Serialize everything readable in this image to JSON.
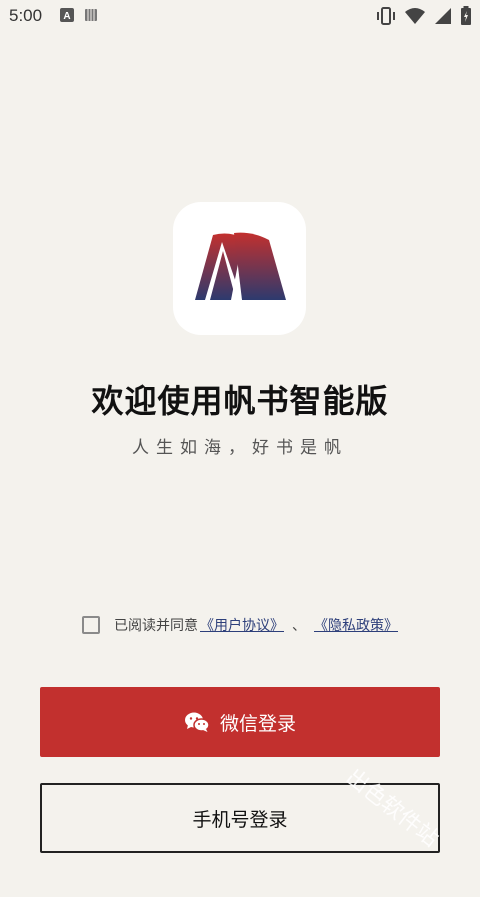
{
  "status_bar": {
    "time": "5:00",
    "left_icons": [
      "a-icon",
      "storage-icon"
    ],
    "right_icons": [
      "vibrate-icon",
      "wifi-icon",
      "signal-icon",
      "battery-icon"
    ]
  },
  "logo": {
    "icon": "fanshu-logo-icon",
    "gradient_top": "#c2302e",
    "gradient_bottom": "#2d3a6e"
  },
  "welcome": {
    "title": "欢迎使用帆书智能版",
    "slogan": "人生如海，好书是帆"
  },
  "agreement": {
    "prefix": "已阅读并同意",
    "user_agreement": "《用户协议》",
    "separator": "、",
    "privacy_policy": "《隐私政策》",
    "checked": false
  },
  "buttons": {
    "wechat_login": "微信登录",
    "phone_login": "手机号登录"
  },
  "watermark": "出色软件站",
  "colors": {
    "background": "#f4f2ed",
    "primary": "#c2302e",
    "link": "#2d3f7a"
  }
}
